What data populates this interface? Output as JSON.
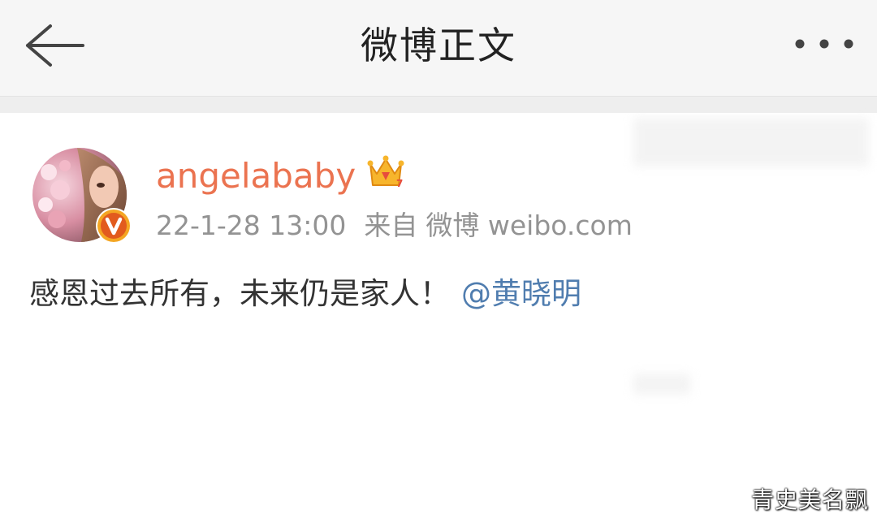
{
  "header": {
    "title": "微博正文",
    "back_icon": "arrow-left-icon",
    "more_icon": "more-horizontal-icon"
  },
  "post": {
    "username": "angelababy",
    "username_color": "#eb7350",
    "member_badge_icon": "crown-icon",
    "verified_badge_icon": "verified-v-icon",
    "timestamp": "22-1-28 13:00",
    "source_prefix": "来自",
    "source": "微博 weibo.com",
    "text": "感恩过去所有，未来仍是家人！",
    "mention": "@黄晓明",
    "mention_color": "#507daf"
  },
  "watermark": "青史美名飘"
}
